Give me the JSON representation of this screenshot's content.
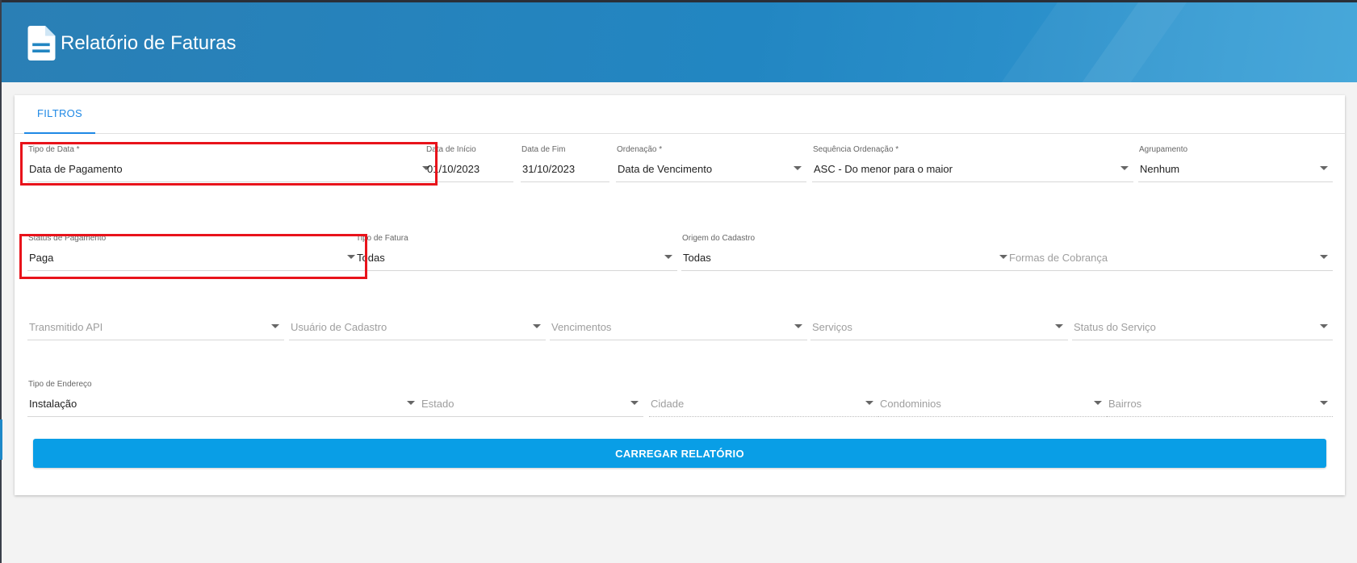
{
  "header": {
    "title": "Relatório de Faturas",
    "icon": "document-icon"
  },
  "tabs": [
    {
      "label": "FILTROS",
      "active": true
    }
  ],
  "filters": {
    "tipo_data": {
      "label": "Tipo de Data *",
      "value": "Data de Pagamento"
    },
    "data_inicio": {
      "label": "Data de Início",
      "value": "01/10/2023"
    },
    "data_fim": {
      "label": "Data de Fim",
      "value": "31/10/2023"
    },
    "ordenacao": {
      "label": "Ordenação *",
      "value": "Data de Vencimento"
    },
    "sequencia": {
      "label": "Sequência Ordenação *",
      "value": "ASC - Do menor para o maior"
    },
    "agrupamento": {
      "label": "Agrupamento",
      "value": "Nenhum"
    },
    "status_pagamento": {
      "label": "Status de Pagamento",
      "value": "Paga"
    },
    "tipo_fatura": {
      "label": "Tipo de Fatura",
      "value": "Todas"
    },
    "origem_cadastro": {
      "label": "Origem do Cadastro",
      "value": "Todas"
    },
    "formas_cobranca": {
      "placeholder": "Formas de Cobrança"
    },
    "transmitido_api": {
      "placeholder": "Transmitido API"
    },
    "usuario_cadastro": {
      "placeholder": "Usuário de Cadastro"
    },
    "vencimentos": {
      "placeholder": "Vencimentos"
    },
    "servicos": {
      "placeholder": "Serviços"
    },
    "status_servico": {
      "placeholder": "Status do Serviço"
    },
    "tipo_endereco": {
      "label": "Tipo de Endereço",
      "value": "Instalação"
    },
    "estado": {
      "placeholder": "Estado"
    },
    "cidade": {
      "placeholder": "Cidade"
    },
    "condominios": {
      "placeholder": "Condominios"
    },
    "bairros": {
      "placeholder": "Bairros"
    }
  },
  "actions": {
    "carregar_label": "CARREGAR RELATÓRIO"
  },
  "colors": {
    "header": "#2286c2",
    "accent": "#1e88e5",
    "button": "#099ee6",
    "highlight": "#e8131b"
  }
}
